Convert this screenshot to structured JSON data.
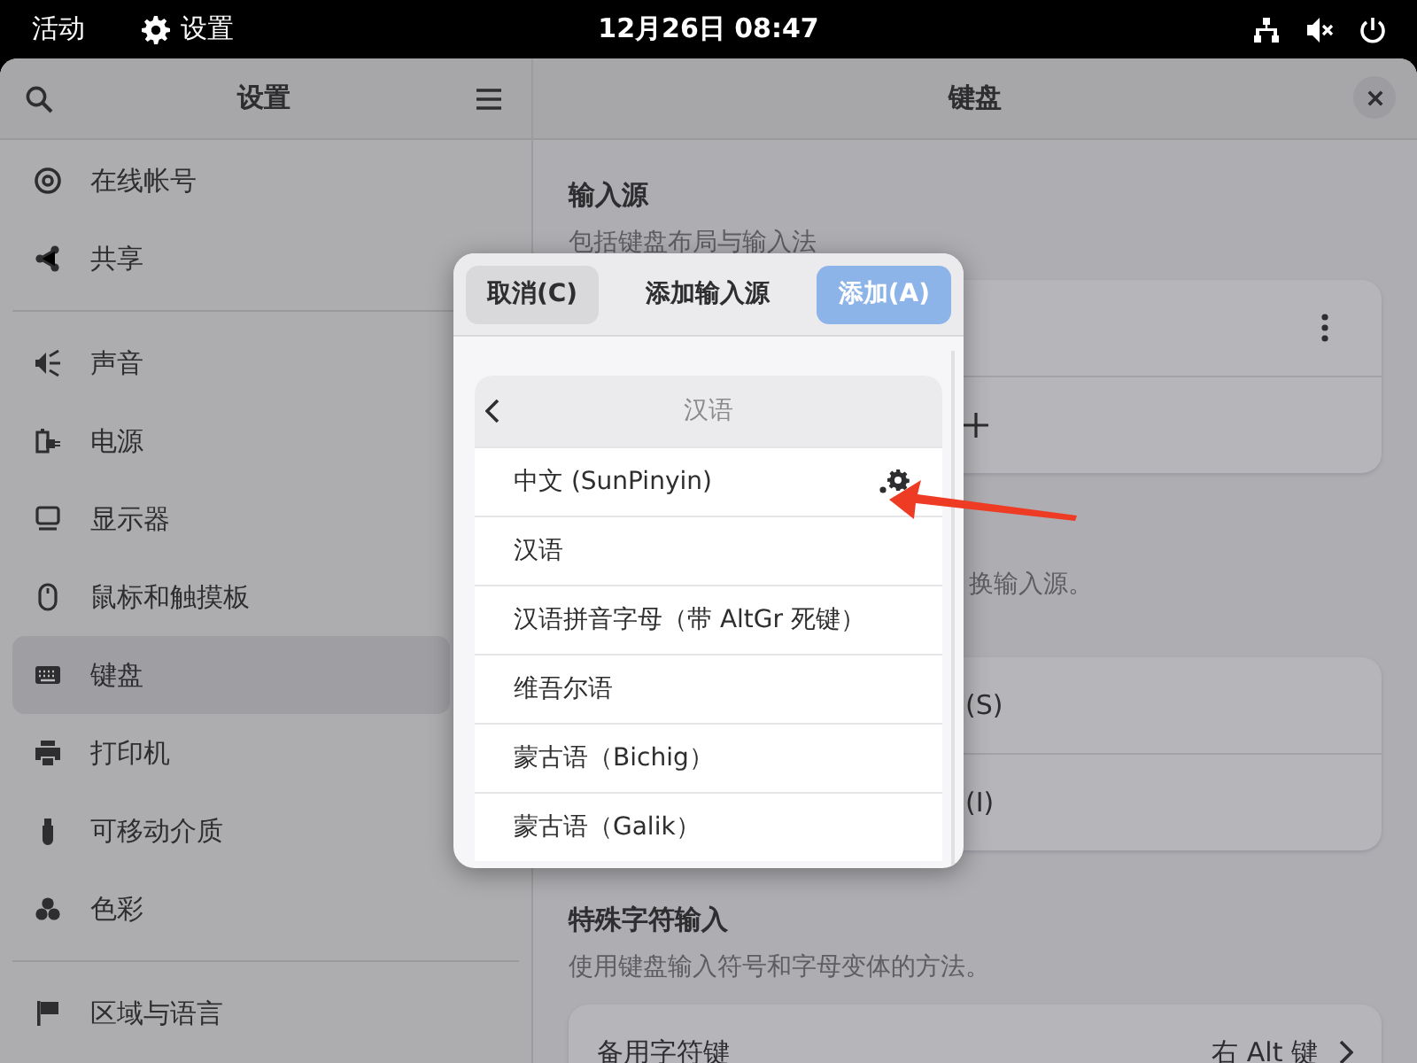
{
  "top_bar": {
    "activities": "活动",
    "app_menu": "设置",
    "clock": "12月26日  08:47"
  },
  "sidebar": {
    "title": "设置",
    "groups": [
      [
        {
          "label": "在线帐号",
          "selected": false
        },
        {
          "label": "共享",
          "selected": false
        }
      ],
      [
        {
          "label": "声音",
          "selected": false
        },
        {
          "label": "电源",
          "selected": false
        },
        {
          "label": "显示器",
          "selected": false
        },
        {
          "label": "鼠标和触摸板",
          "selected": false
        },
        {
          "label": "键盘",
          "selected": true
        },
        {
          "label": "打印机",
          "selected": false
        },
        {
          "label": "可移动介质",
          "selected": false
        },
        {
          "label": "色彩",
          "selected": false
        }
      ],
      [
        {
          "label": "区域与语言",
          "selected": false
        }
      ]
    ]
  },
  "content": {
    "title": "键盘",
    "input_sources": {
      "heading": "输入源",
      "subtitle": "包括键盘布局与输入法"
    },
    "switching": {
      "subtitle_fragment": "换输入源。",
      "rows": [
        "(S)",
        "(I)"
      ]
    },
    "special_chars": {
      "heading": "特殊字符输入",
      "subtitle": "使用键盘输入符号和字母变体的方法。",
      "row_label": "备用字符键",
      "row_value": "右 Alt 键"
    }
  },
  "dialog": {
    "cancel": "取消(C)",
    "title": "添加输入源",
    "add": "添加(A)",
    "list_title": "汉语",
    "items": [
      {
        "label": "中文 (SunPinyin)",
        "settings": true
      },
      {
        "label": "汉语",
        "settings": false
      },
      {
        "label": "汉语拼音字母（带 AltGr 死键）",
        "settings": false
      },
      {
        "label": "维吾尔语",
        "settings": false
      },
      {
        "label": "蒙古语（Bichig）",
        "settings": false
      },
      {
        "label": "蒙古语（Galik）",
        "settings": false
      }
    ]
  }
}
